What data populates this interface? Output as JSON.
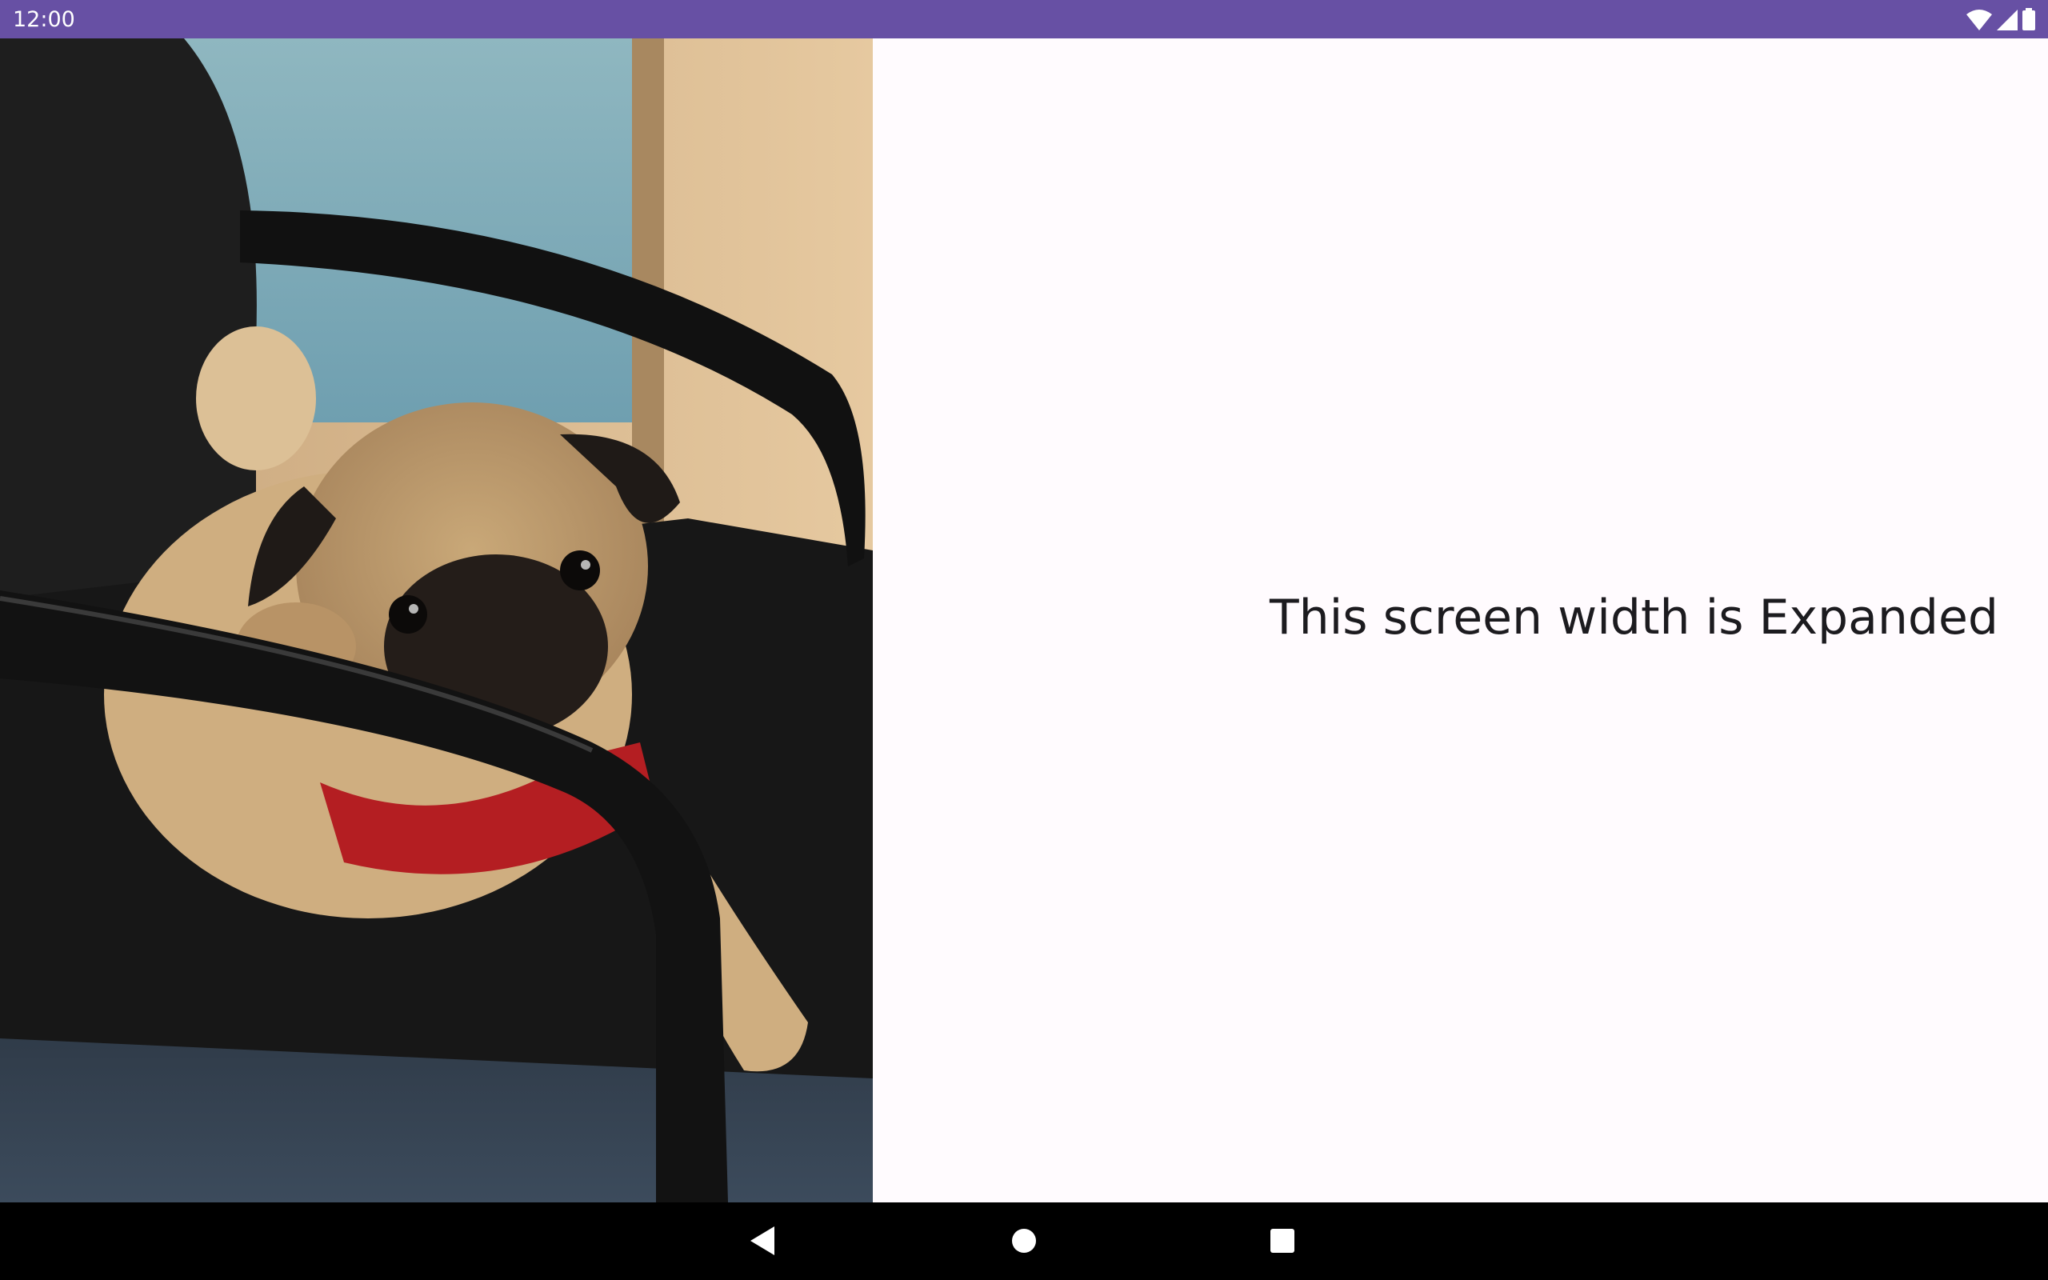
{
  "status_bar": {
    "time": "12:00",
    "background": "#6750A4",
    "icons": [
      "wifi-icon",
      "cellular-signal-icon",
      "battery-icon"
    ]
  },
  "main": {
    "image": {
      "subject": "pug resting its head on a black office chair armrest"
    },
    "width_class_text": "This screen width is Expanded",
    "background": "#FFFBFE",
    "text_color": "#1C1B1F"
  },
  "nav_bar": {
    "buttons": [
      "back-icon",
      "home-icon",
      "recents-icon"
    ],
    "background": "#000000"
  }
}
